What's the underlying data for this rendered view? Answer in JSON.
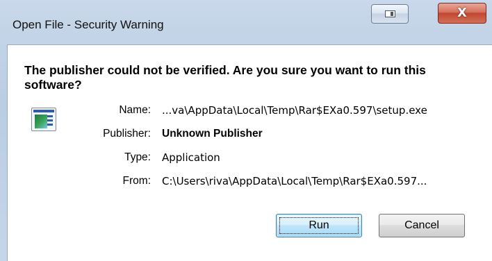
{
  "window": {
    "title": "Open File - Security Warning",
    "restore_icon": "restore-icon",
    "close_glyph": "X",
    "close_icon": "close-icon"
  },
  "warning": {
    "headline": "The publisher could not be verified.  Are you sure you want to run this software?"
  },
  "details": {
    "icon": "application-icon",
    "name_label": "Name:",
    "name_value": "...va\\AppData\\Local\\Temp\\Rar$EXa0.597\\setup.exe",
    "publisher_label": "Publisher:",
    "publisher_value": "Unknown Publisher",
    "type_label": "Type:",
    "type_value": "Application",
    "from_label": "From:",
    "from_value": "C:\\Users\\riva\\AppData\\Local\\Temp\\Rar$EXa0.597..."
  },
  "buttons": {
    "run_label": "Run",
    "cancel_label": "Cancel"
  },
  "colors": {
    "title_bar": "#c5d6ea",
    "close_button": "#c24530",
    "default_button": "#bee6fd"
  }
}
